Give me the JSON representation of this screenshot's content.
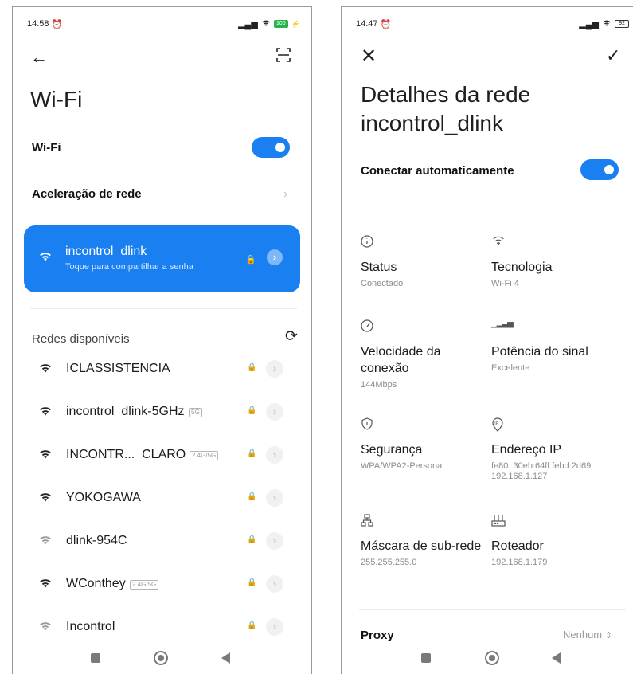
{
  "left": {
    "status": {
      "time": "14:58",
      "battery": "100"
    },
    "title": "Wi-Fi",
    "wifi_toggle_label": "Wi-Fi",
    "wifi_enabled": true,
    "acceleration_label": "Aceleração de rede",
    "connected": {
      "ssid": "incontrol_dlink",
      "subtitle": "Toque para compartilhar a senha"
    },
    "available_label": "Redes disponíveis",
    "networks": [
      {
        "name": "ICLASSISTENCIA",
        "tag": "",
        "signal": "strong"
      },
      {
        "name": "incontrol_dlink-5GHz",
        "tag": "5G",
        "signal": "strong"
      },
      {
        "name": "INCONTR..._CLARO",
        "tag": "2.4G/5G",
        "signal": "strong"
      },
      {
        "name": "YOKOGAWA",
        "tag": "",
        "signal": "strong"
      },
      {
        "name": "dlink-954C",
        "tag": "",
        "signal": "weak"
      },
      {
        "name": "WConthey",
        "tag": "2.4G/5G",
        "signal": "strong"
      },
      {
        "name": "Incontrol",
        "tag": "",
        "signal": "weak"
      }
    ]
  },
  "right": {
    "status": {
      "time": "14:47",
      "battery": "92"
    },
    "title": "Detalhes da rede incontrol_dlink",
    "auto_connect_label": "Conectar automaticamente",
    "auto_connect_enabled": true,
    "details": {
      "status": {
        "label": "Status",
        "value": "Conectado",
        "icon": "info-icon"
      },
      "technology": {
        "label": "Tecnologia",
        "value": "Wi-Fi 4",
        "icon": "wifi-icon"
      },
      "speed": {
        "label": "Velocidade da conexão",
        "value": "144Mbps",
        "icon": "speedometer-icon"
      },
      "signal": {
        "label": "Potência do sinal",
        "value": "Excelente",
        "icon": "signal-bars-icon"
      },
      "security": {
        "label": "Segurança",
        "value": "WPA/WPA2-Personal",
        "icon": "shield-icon"
      },
      "ip": {
        "label": "Endereço IP",
        "value": "fe80::30eb:64ff:febd:2d69\n192.168.1.127",
        "icon": "ip-icon"
      },
      "mask": {
        "label": "Máscara de sub-rede",
        "value": "255.255.255.0",
        "icon": "network-tree-icon"
      },
      "router": {
        "label": "Roteador",
        "value": "192.168.1.179",
        "icon": "router-icon"
      }
    },
    "proxy_label": "Proxy",
    "proxy_value": "Nenhum"
  },
  "colors": {
    "accent": "#1a80f2",
    "muted": "#8c8c8c"
  }
}
